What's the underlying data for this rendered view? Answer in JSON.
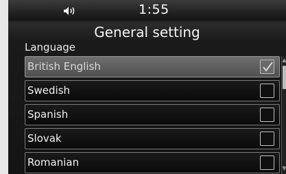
{
  "status_bar": {
    "volume_icon": "speaker-volume-icon",
    "time": "1:55"
  },
  "header": {
    "title": "General setting"
  },
  "section": {
    "label": "Language"
  },
  "languages": [
    {
      "label": "British English",
      "checked": true,
      "highlighted": true
    },
    {
      "label": "Swedish",
      "checked": false,
      "highlighted": false
    },
    {
      "label": "Spanish",
      "checked": false,
      "highlighted": false
    },
    {
      "label": "Slovak",
      "checked": false,
      "highlighted": false
    },
    {
      "label": "Romanian",
      "checked": false,
      "highlighted": false
    }
  ],
  "scrollbar": {
    "up_icon": "scroll-up-arrow-icon",
    "down_icon": "scroll-down-arrow-icon"
  },
  "colors": {
    "background": "#141414",
    "highlight_row": "#5f5f5f",
    "border": "#7c7c7c",
    "text": "#f2f2f2"
  }
}
